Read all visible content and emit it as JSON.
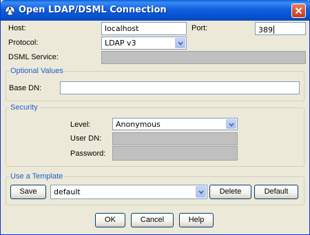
{
  "window": {
    "title": "Open LDAP/DSML Connection"
  },
  "connection": {
    "host_label": "Host:",
    "host_value": "localhost",
    "port_label": "Port:",
    "port_value": "389",
    "protocol_label": "Protocol:",
    "protocol_value": "LDAP v3",
    "dsml_label": "DSML Service:",
    "dsml_value": ""
  },
  "optional": {
    "title": "Optional Values",
    "basedn_label": "Base DN:",
    "basedn_value": ""
  },
  "security": {
    "title": "Security",
    "level_label": "Level:",
    "level_value": "Anonymous",
    "userdn_label": "User DN:",
    "userdn_value": "",
    "password_label": "Password:",
    "password_value": ""
  },
  "template": {
    "title": "Use a Template",
    "save_label": "Save",
    "template_value": "default",
    "delete_label": "Delete",
    "default_label": "Default"
  },
  "footer": {
    "ok_label": "OK",
    "cancel_label": "Cancel",
    "help_label": "Help"
  },
  "icons": {
    "title": "ldap-connection-icon",
    "close": "close-icon",
    "dropdown": "chevron-down-icon"
  },
  "colors": {
    "titlebar": "#0a5fd8",
    "dialog_bg": "#ece9d8",
    "group_title": "#1d5fcf",
    "close_button": "#d4502f",
    "disabled_field": "#c0c0c0"
  }
}
